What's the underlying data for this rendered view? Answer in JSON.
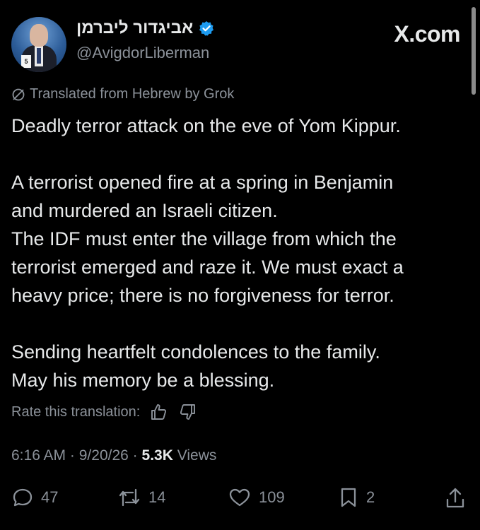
{
  "header": {
    "display_name": "אביגדור ליברמן",
    "handle": "@AvigdorLiberman",
    "site": "X.com"
  },
  "post": {
    "translation_note": "Translated from Hebrew by Grok",
    "paragraphs": [
      [
        "Deadly terror attack on the eve of Yom Kippur."
      ],
      [
        "A terrorist opened fire at a spring in Benjamin",
        "and murdered an Israeli citizen.",
        "The IDF must enter the village from which the",
        "terrorist emerged and raze it. We must exact a",
        "heavy price; there is no forgiveness for terror."
      ],
      [
        "Sending heartfelt condolences to the family.",
        "May his memory be a blessing."
      ]
    ],
    "rate_label": "Rate this translation:",
    "meta": {
      "time": "6:16 AM",
      "date": "9/20/26",
      "sep": "·",
      "views_count": "5.3K",
      "views_label": "Views"
    }
  },
  "actions": {
    "replies": "47",
    "reposts": "14",
    "likes": "109",
    "bookmarks": "2"
  },
  "icons": [
    "verified-badge-icon",
    "grok-icon",
    "thumbs-up-icon",
    "thumbs-down-icon",
    "reply-icon",
    "repost-icon",
    "like-icon",
    "bookmark-icon",
    "share-icon"
  ],
  "colors": {
    "background": "#000000",
    "text": "#e7e9ea",
    "muted": "#8b9199",
    "verified": "#1d9bf0"
  }
}
